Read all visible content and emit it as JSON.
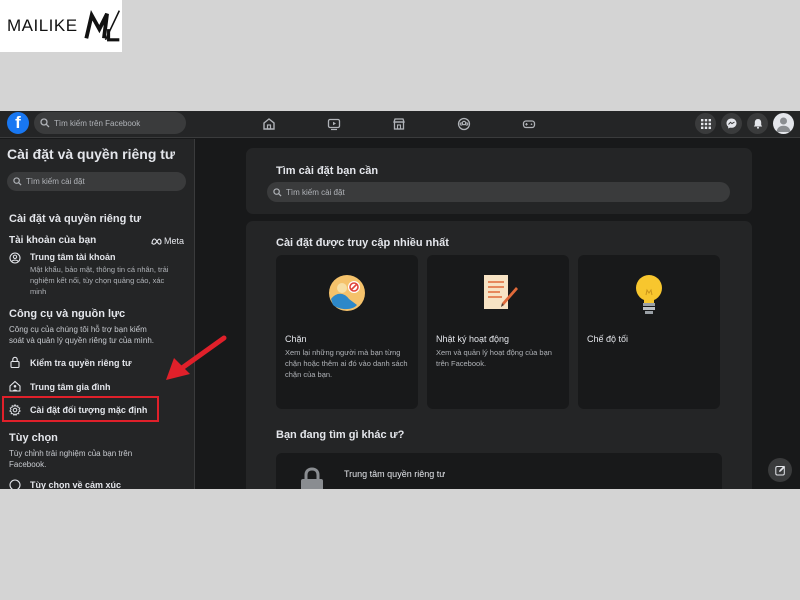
{
  "watermark": {
    "text": "MAILIKE"
  },
  "topbar": {
    "search_placeholder": "Tìm kiếm trên Facebook",
    "logo_letter": "f"
  },
  "sidebar": {
    "title": "Cài đặt và quyền riêng tư",
    "search_placeholder": "Tìm kiếm cài đặt",
    "section1": "Cài đặt và quyền riêng tư",
    "account_heading": "Tài khoản của bạn",
    "meta_label": "Meta",
    "accounts_center": {
      "label": "Trung tâm tài khoản",
      "desc_line1": "Mật khẩu, bảo mật, thông tin cá nhân, trải",
      "desc_line2": "nghiệm kết nối, tùy chọn quảng cáo, xác",
      "desc_line3": "minh"
    },
    "tools_heading": "Công cụ và nguồn lực",
    "tools_desc_line1": "Công cụ của chúng tôi hỗ trợ bạn kiểm",
    "tools_desc_line2": "soát và quản lý quyền riêng tư của mình.",
    "items": [
      {
        "label": "Kiểm tra quyền riêng tư",
        "icon": "lock-icon"
      },
      {
        "label": "Trung tâm gia đình",
        "icon": "family-icon"
      },
      {
        "label": "Cài đặt đối tượng mặc định",
        "icon": "gear-icon"
      }
    ],
    "preferences_heading": "Tùy chọn",
    "preferences_desc_line1": "Tùy chỉnh trải nghiệm của bạn trên",
    "preferences_desc_line2": "Facebook.",
    "reaction_item": "Tùy chọn về cảm xúc"
  },
  "main": {
    "find_title": "Tìm cài đặt bạn cần",
    "find_placeholder": "Tìm kiếm cài đặt",
    "most_visited_title": "Cài đặt được truy cập nhiều nhất",
    "tiles": [
      {
        "title": "Chặn",
        "desc": "Xem lại những người mà bạn từng chặn hoặc thêm ai đó vào danh sách chặn của bạn."
      },
      {
        "title": "Nhật ký hoạt động",
        "desc": "Xem và quản lý hoạt động của bạn trên Facebook."
      },
      {
        "title": "Chế độ tối",
        "desc": ""
      }
    ],
    "other_title": "Bạn đang tìm gì khác ư?",
    "privacy_center_label": "Trung tâm quyền riêng tư"
  },
  "colors": {
    "background": "#18191a",
    "surface": "#242526",
    "input": "#3a3b3c",
    "accent": "#1877f2",
    "highlight": "#e0202a"
  }
}
